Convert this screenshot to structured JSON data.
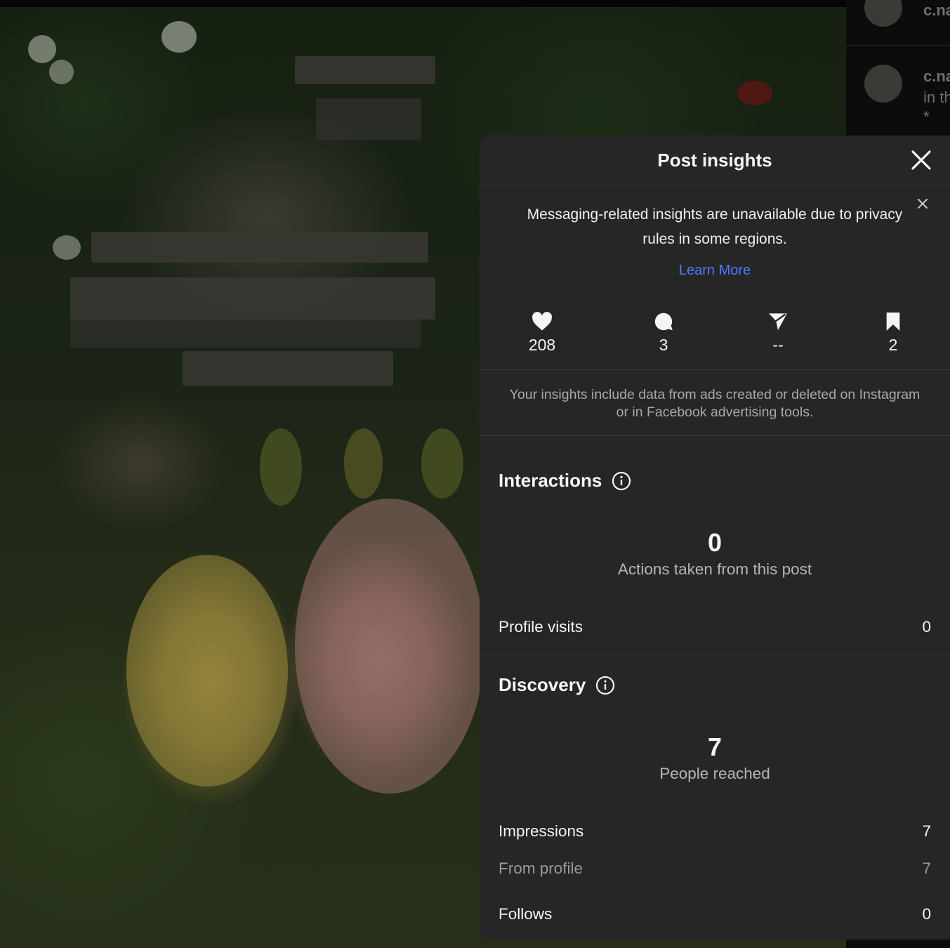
{
  "modal": {
    "title": "Post insights",
    "notice": {
      "text": "Messaging-related insights are unavailable due to privacy rules in some regions.",
      "link": "Learn More"
    },
    "stats": {
      "likes": "208",
      "comments": "3",
      "shares": "--",
      "saves": "2"
    },
    "ads_note": "Your insights include data from ads created or deleted on Instagram or in Facebook advertising tools.",
    "interactions": {
      "title": "Interactions",
      "total": "0",
      "total_label": "Actions taken from this post",
      "profile_visits_label": "Profile visits",
      "profile_visits_value": "0"
    },
    "discovery": {
      "title": "Discovery",
      "reached": "7",
      "reached_label": "People reached",
      "impressions_label": "Impressions",
      "impressions_value": "7",
      "from_profile_label": "From profile",
      "from_profile_value": "7",
      "follows_label": "Follows",
      "follows_value": "0"
    }
  },
  "sidebar": {
    "comment1_user": "c.na",
    "comment2_user": "c.na",
    "comment2_text": "in th",
    "comment2_extra": "*"
  },
  "colors": {
    "modal_bg": "#262626",
    "link": "#4a7dff",
    "text_secondary": "#a8a8a8"
  },
  "icons": [
    "close-icon",
    "heart-icon",
    "comment-icon",
    "share-icon",
    "bookmark-icon",
    "info-icon"
  ]
}
